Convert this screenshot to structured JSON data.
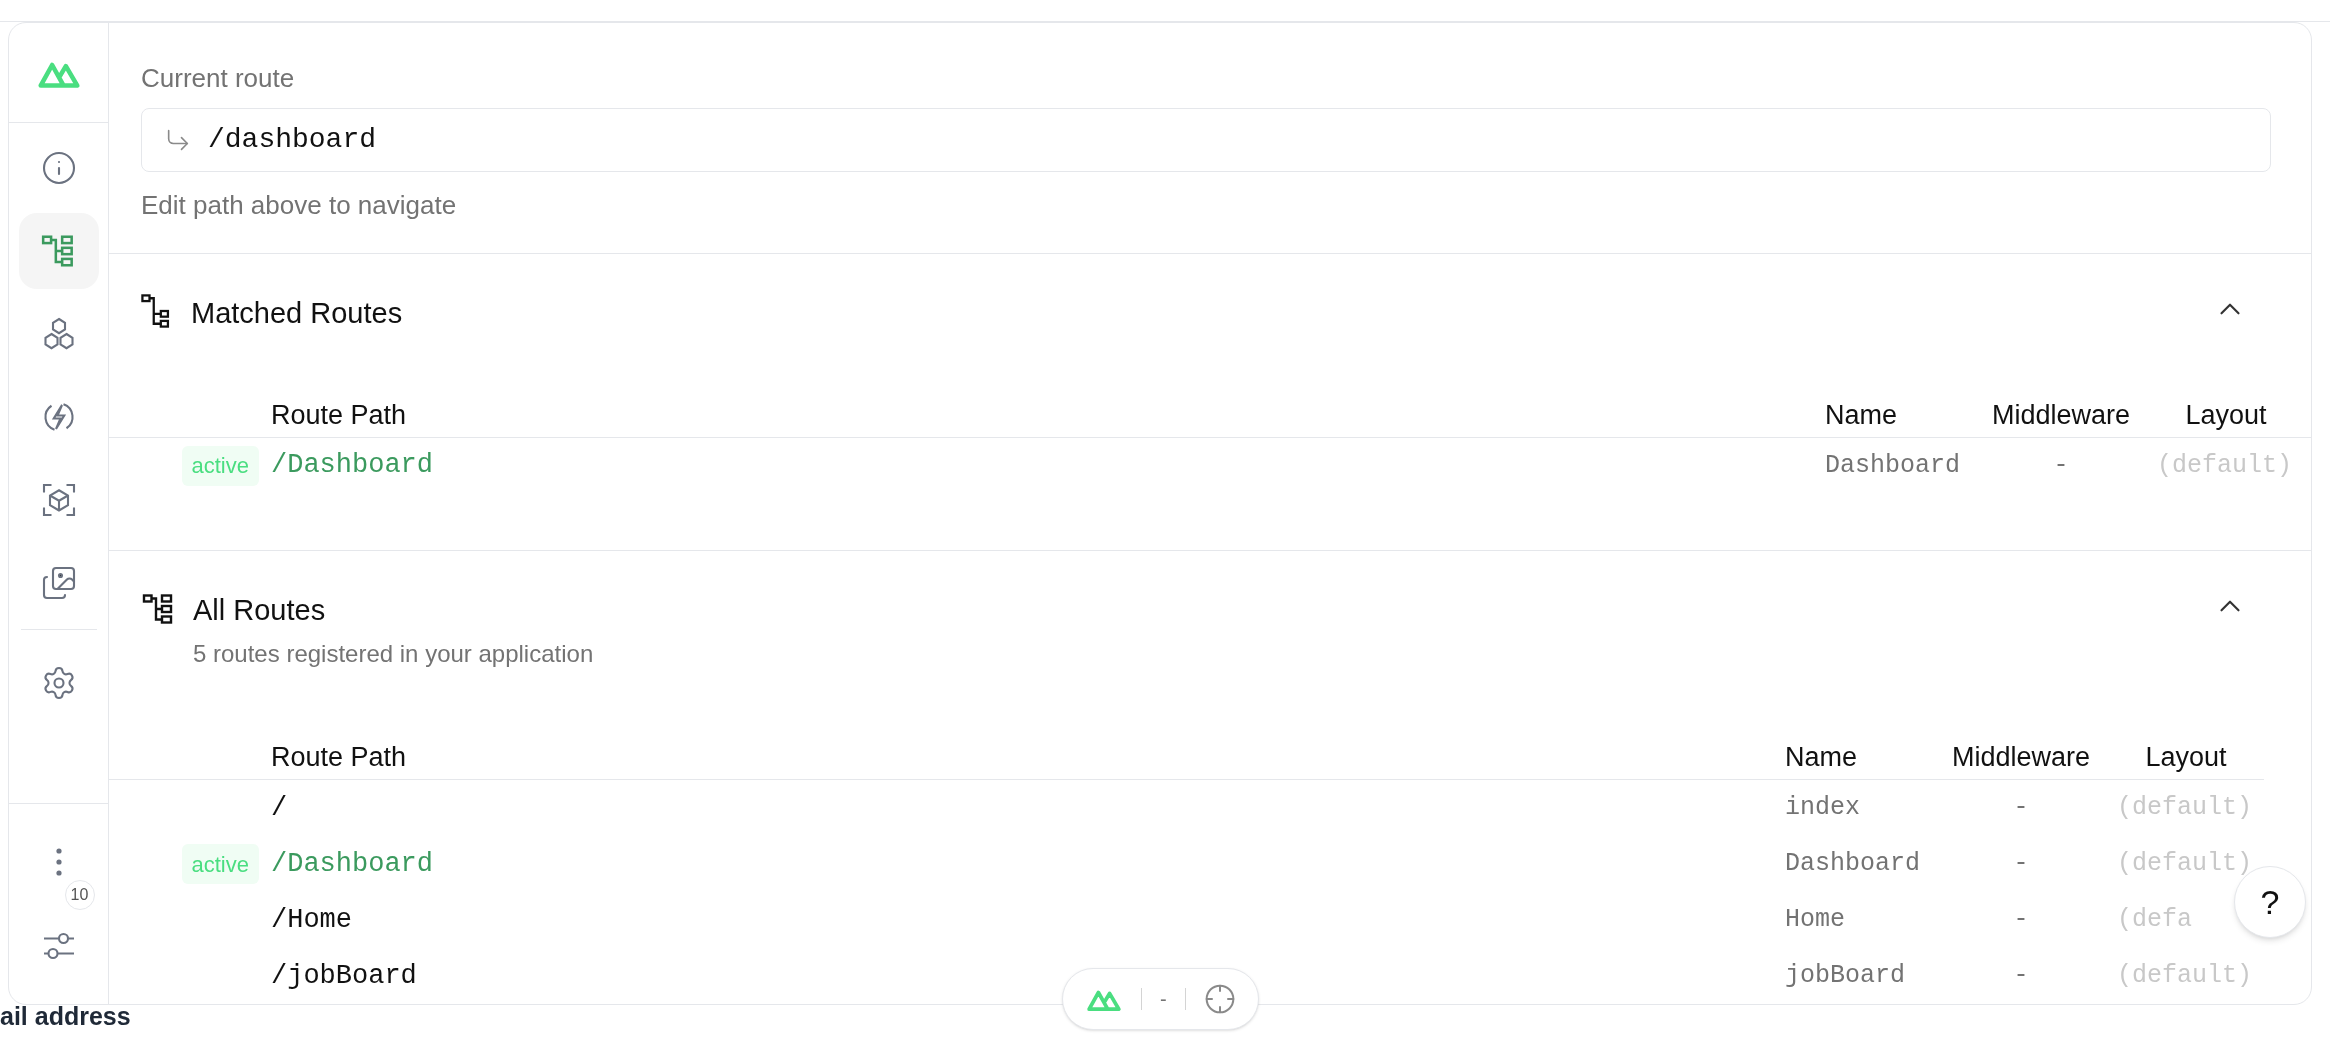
{
  "sidebar": {
    "items": [
      {
        "selected": false
      },
      {
        "selected": true
      },
      {
        "selected": false
      },
      {
        "selected": false
      },
      {
        "selected": false
      },
      {
        "selected": false
      },
      {
        "selected": false
      }
    ],
    "more_count": "10"
  },
  "current_route": {
    "label": "Current route",
    "value": "/dashboard",
    "hint": "Edit path above to navigate"
  },
  "sections": [
    {
      "title": "Matched Routes",
      "expanded": true,
      "columns": [
        "Route Path",
        "Name",
        "Middleware",
        "Layout"
      ],
      "rows": [
        {
          "active": true,
          "badge": "active",
          "path": "/Dashboard",
          "name": "Dashboard",
          "middleware": "-",
          "layout": "(default)"
        }
      ]
    },
    {
      "title": "All Routes",
      "subtitle": "5 routes registered in your application",
      "expanded": true,
      "columns": [
        "Route Path",
        "Name",
        "Middleware",
        "Layout"
      ],
      "rows": [
        {
          "active": false,
          "path": "/",
          "name": "index",
          "middleware": "-",
          "layout": "(default)"
        },
        {
          "active": true,
          "badge": "active",
          "path": "/Dashboard",
          "name": "Dashboard",
          "middleware": "-",
          "layout": "(default)"
        },
        {
          "active": false,
          "path": "/Home",
          "name": "Home",
          "middleware": "-",
          "layout": "(defa"
        },
        {
          "active": false,
          "path": "/jobBoard",
          "name": "jobBoard",
          "middleware": "-",
          "layout": "(default)"
        }
      ]
    }
  ],
  "help_button": "?",
  "bottom_bar": {
    "value": "-"
  },
  "background_text": "ail address"
}
